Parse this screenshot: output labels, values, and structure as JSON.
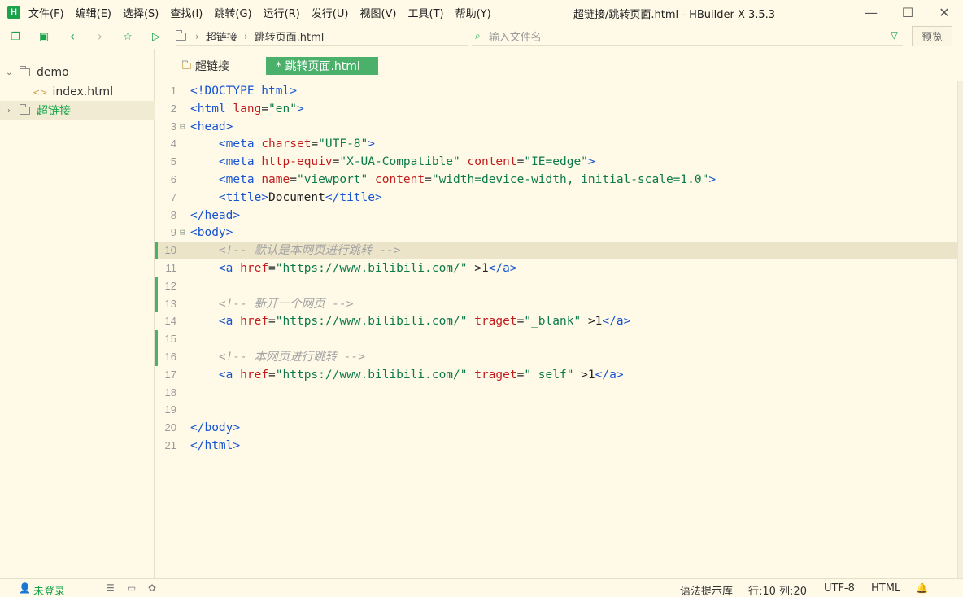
{
  "menu": [
    "文件(F)",
    "编辑(E)",
    "选择(S)",
    "查找(I)",
    "跳转(G)",
    "运行(R)",
    "发行(U)",
    "视图(V)",
    "工具(T)",
    "帮助(Y)"
  ],
  "window_title": "超链接/跳转页面.html - HBuilder X 3.5.3",
  "breadcrumb": [
    "超链接",
    "跳转页面.html"
  ],
  "search_placeholder": "输入文件名",
  "preview_label": "预览",
  "tree": {
    "project": "demo",
    "file": "index.html",
    "folder": "超链接"
  },
  "tabs": {
    "folder": "超链接",
    "active": "* 跳转页面.html"
  },
  "code_lines": [
    [
      [
        "t",
        "<!DOCTYPE html>"
      ]
    ],
    [
      [
        "t",
        "<html "
      ],
      [
        "a",
        "lang"
      ],
      [
        "p",
        "="
      ],
      [
        "s",
        "\"en\""
      ],
      [
        "t",
        ">"
      ]
    ],
    [
      [
        "t",
        "<head>"
      ]
    ],
    [
      [
        "p",
        "    "
      ],
      [
        "t",
        "<meta "
      ],
      [
        "a",
        "charset"
      ],
      [
        "p",
        "="
      ],
      [
        "s",
        "\"UTF-8\""
      ],
      [
        "t",
        ">"
      ]
    ],
    [
      [
        "p",
        "    "
      ],
      [
        "t",
        "<meta "
      ],
      [
        "a",
        "http-equiv"
      ],
      [
        "p",
        "="
      ],
      [
        "s",
        "\"X-UA-Compatible\""
      ],
      [
        "p",
        " "
      ],
      [
        "a",
        "content"
      ],
      [
        "p",
        "="
      ],
      [
        "s",
        "\"IE=edge\""
      ],
      [
        "t",
        ">"
      ]
    ],
    [
      [
        "p",
        "    "
      ],
      [
        "t",
        "<meta "
      ],
      [
        "a",
        "name"
      ],
      [
        "p",
        "="
      ],
      [
        "s",
        "\"viewport\""
      ],
      [
        "p",
        " "
      ],
      [
        "a",
        "content"
      ],
      [
        "p",
        "="
      ],
      [
        "s",
        "\"width=device-width, initial-scale=1.0\""
      ],
      [
        "t",
        ">"
      ]
    ],
    [
      [
        "p",
        "    "
      ],
      [
        "t",
        "<title>"
      ],
      [
        "p",
        "Document"
      ],
      [
        "t",
        "</title>"
      ]
    ],
    [
      [
        "t",
        "</head>"
      ]
    ],
    [
      [
        "t",
        "<body>"
      ]
    ],
    [
      [
        "p",
        "    "
      ],
      [
        "c",
        "<!-- 默认是本网页进行跳转 -->"
      ]
    ],
    [
      [
        "p",
        "    "
      ],
      [
        "t",
        "<a "
      ],
      [
        "a",
        "href"
      ],
      [
        "p",
        "="
      ],
      [
        "s",
        "\"https://www.bilibili.com/\""
      ],
      [
        "p",
        " >1"
      ],
      [
        "t",
        "</a>"
      ]
    ],
    [],
    [
      [
        "p",
        "    "
      ],
      [
        "c",
        "<!-- 新开一个网页 -->"
      ]
    ],
    [
      [
        "p",
        "    "
      ],
      [
        "t",
        "<a "
      ],
      [
        "a",
        "href"
      ],
      [
        "p",
        "="
      ],
      [
        "s",
        "\"https://www.bilibili.com/\""
      ],
      [
        "p",
        " "
      ],
      [
        "a",
        "traget"
      ],
      [
        "p",
        "="
      ],
      [
        "s",
        "\"_blank\""
      ],
      [
        "p",
        " >1"
      ],
      [
        "t",
        "</a>"
      ]
    ],
    [],
    [
      [
        "p",
        "    "
      ],
      [
        "c",
        "<!-- 本网页进行跳转 -->"
      ]
    ],
    [
      [
        "p",
        "    "
      ],
      [
        "t",
        "<a "
      ],
      [
        "a",
        "href"
      ],
      [
        "p",
        "="
      ],
      [
        "s",
        "\"https://www.bilibili.com/\""
      ],
      [
        "p",
        " "
      ],
      [
        "a",
        "traget"
      ],
      [
        "p",
        "="
      ],
      [
        "s",
        "\"_self\""
      ],
      [
        "p",
        " >1"
      ],
      [
        "t",
        "</a>"
      ]
    ],
    [],
    [],
    [
      [
        "t",
        "</body>"
      ]
    ],
    [
      [
        "t",
        "</html>"
      ]
    ]
  ],
  "current_line": 10,
  "status": {
    "login": "未登录",
    "lib": "语法提示库",
    "position": "行:10  列:20",
    "encoding": "UTF-8",
    "lang": "HTML"
  },
  "colors": {
    "accent": "#4bb06a",
    "tag": "#1754cf",
    "attr": "#c21c1c",
    "string": "#0c7a4a",
    "comment": "#a3a3a3"
  }
}
